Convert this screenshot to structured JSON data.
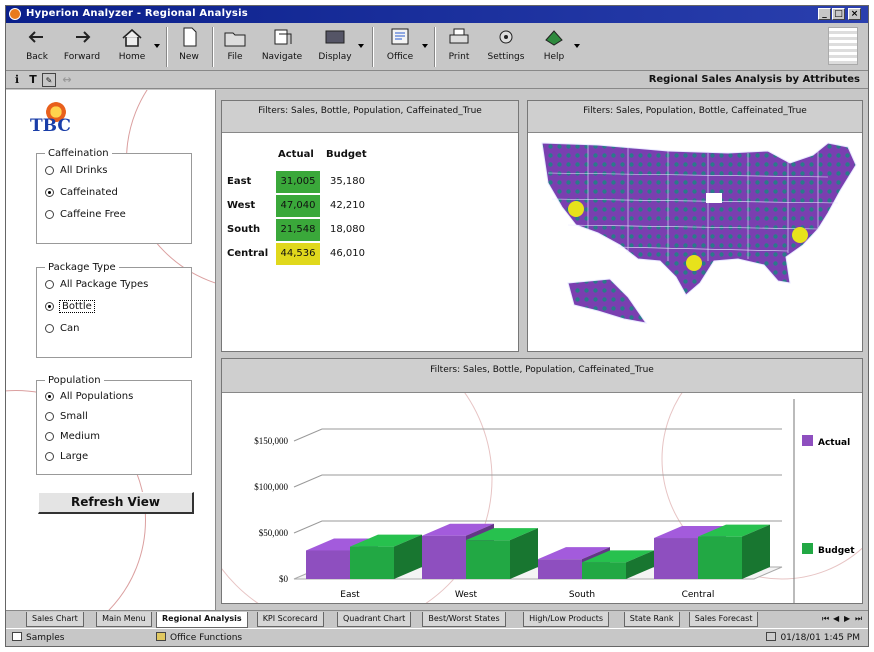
{
  "window": {
    "title": "Hyperion Analyzer - Regional Analysis"
  },
  "toolbar": {
    "items": [
      {
        "label": "Back",
        "icon": "back-arrow-icon"
      },
      {
        "label": "Forward",
        "icon": "forward-arrow-icon"
      },
      {
        "label": "Home",
        "icon": "home-icon"
      },
      {
        "label": "New",
        "icon": "new-document-icon"
      },
      {
        "label": "File",
        "icon": "file-folder-icon"
      },
      {
        "label": "Navigate",
        "icon": "navigate-icon"
      },
      {
        "label": "Display",
        "icon": "display-icon"
      },
      {
        "label": "Office",
        "icon": "office-icon"
      },
      {
        "label": "Print",
        "icon": "printer-icon"
      },
      {
        "label": "Settings",
        "icon": "settings-icon"
      },
      {
        "label": "Help",
        "icon": "help-icon"
      }
    ]
  },
  "report": {
    "title": "Regional Sales Analysis by Attributes"
  },
  "logo": {
    "text": "TBC"
  },
  "filters": {
    "caffeination": {
      "legend": "Caffeination",
      "options": [
        "All Drinks",
        "Caffeinated",
        "Caffeine Free"
      ],
      "selected": 1
    },
    "package_type": {
      "legend": "Package Type",
      "options": [
        "All Package Types",
        "Bottle",
        "Can"
      ],
      "selected": 1
    },
    "population": {
      "legend": "Population",
      "options": [
        "All Populations",
        "Small",
        "Medium",
        "Large"
      ],
      "selected": 0
    },
    "refresh_label": "Refresh View"
  },
  "table_panel": {
    "header": "Filters: Sales, Bottle, Population, Caffeinated_True",
    "columns": [
      "Actual",
      "Budget"
    ],
    "rows": [
      {
        "region": "East",
        "actual": "31,005",
        "budget": "35,180",
        "color": "#3aa83a"
      },
      {
        "region": "West",
        "actual": "47,040",
        "budget": "42,210",
        "color": "#3aa83a"
      },
      {
        "region": "South",
        "actual": "21,548",
        "budget": "18,080",
        "color": "#3aa83a"
      },
      {
        "region": "Central",
        "actual": "44,536",
        "budget": "46,010",
        "color": "#e0d81c"
      }
    ]
  },
  "map_panel": {
    "header": "Filters: Sales, Population, Bottle, Caffeinated_True",
    "colors": {
      "fill": "#7a3fb0",
      "dots": "#2a7a8a",
      "markers": "#e7e21b"
    }
  },
  "chart_panel": {
    "header": "Filters: Sales, Bottle, Population, Caffeinated_True"
  },
  "chart_data": {
    "type": "bar",
    "categories": [
      "East",
      "West",
      "South",
      "Central"
    ],
    "series": [
      {
        "name": "Actual",
        "values": [
          31005,
          47040,
          21548,
          44536
        ],
        "color": "#8e4fbf"
      },
      {
        "name": "Budget",
        "values": [
          35180,
          42210,
          18080,
          46010
        ],
        "color": "#22a844"
      }
    ],
    "yticks": [
      "$0",
      "$50,000",
      "$100,000",
      "$150,000"
    ],
    "ylim": [
      0,
      150000
    ],
    "legend": "right"
  },
  "tabs": {
    "items": [
      "Sales Chart",
      "Main Menu",
      "Regional Analysis",
      "KPI Scorecard",
      "Quadrant Chart",
      "Best/Worst States",
      "High/Low Products",
      "State Rank",
      "Sales Forecast"
    ],
    "active": 2
  },
  "status": {
    "left": "Samples",
    "middle": "Office Functions",
    "right": "01/18/01  1:45 PM"
  }
}
